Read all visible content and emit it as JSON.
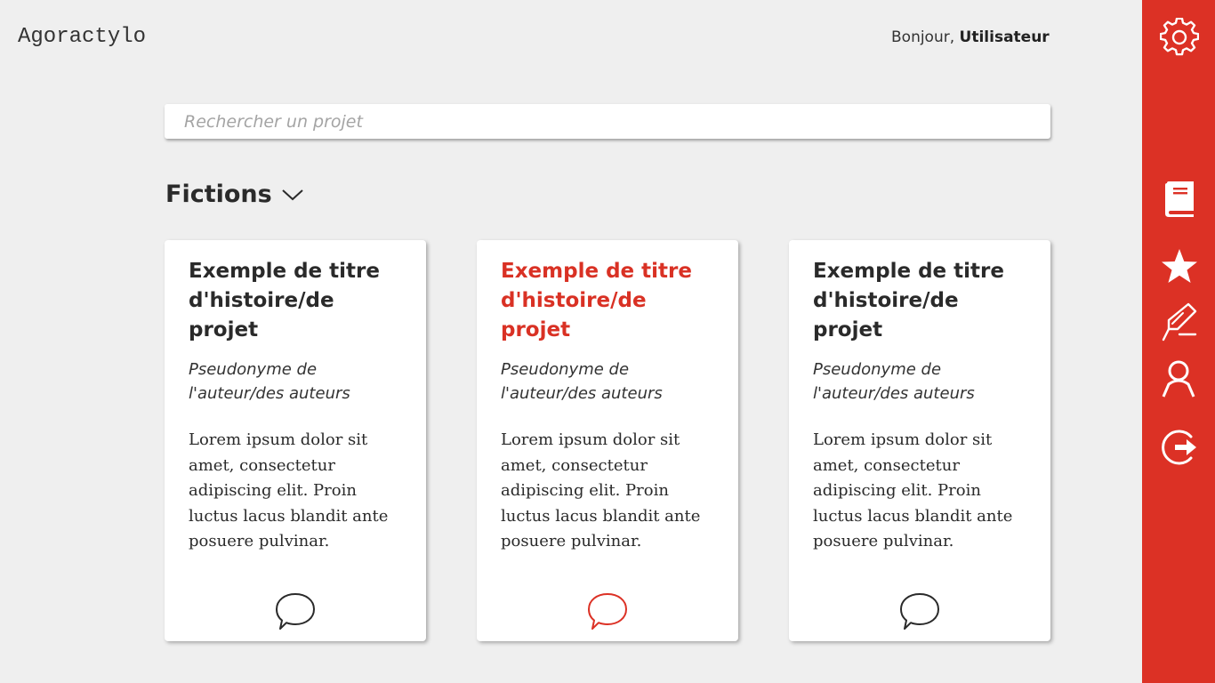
{
  "app": {
    "logo": "Agoractylo"
  },
  "header": {
    "greeting": "Bonjour, ",
    "username": "Utilisateur"
  },
  "search": {
    "placeholder": "Rechercher un projet",
    "value": ""
  },
  "category": {
    "label": "Fictions",
    "icon": "chevron-down-icon"
  },
  "cards": [
    {
      "title": "Exemple de titre d'histoire/de projet",
      "author": "Pseudonyme de l'auteur/des auteurs",
      "description": "Lorem ipsum dolor sit amet, consectetur adipiscing elit. Proin luctus lacus blandit ante posuere pulvinar.",
      "icon": "comment-icon",
      "active": false
    },
    {
      "title": "Exemple de titre d'histoire/de projet",
      "author": "Pseudonyme de l'auteur/des auteurs",
      "description": "Lorem ipsum dolor sit amet, consectetur adipiscing elit. Proin luctus lacus blandit ante posuere pulvinar.",
      "icon": "comment-icon",
      "active": true
    },
    {
      "title": "Exemple de titre d'histoire/de projet",
      "author": "Pseudonyme de l'auteur/des auteurs",
      "description": "Lorem ipsum dolor sit amet, consectetur adipiscing elit. Proin luctus lacus blandit ante posuere pulvinar.",
      "icon": "comment-icon",
      "active": false
    }
  ],
  "sidebar": {
    "icons": [
      "gear-icon",
      "book-icon",
      "star-icon",
      "pen-icon",
      "user-icon",
      "logout-icon"
    ]
  },
  "colors": {
    "accent": "#dc3125",
    "background": "#efefef",
    "card": "#ffffff",
    "text": "#2a2a2a"
  }
}
